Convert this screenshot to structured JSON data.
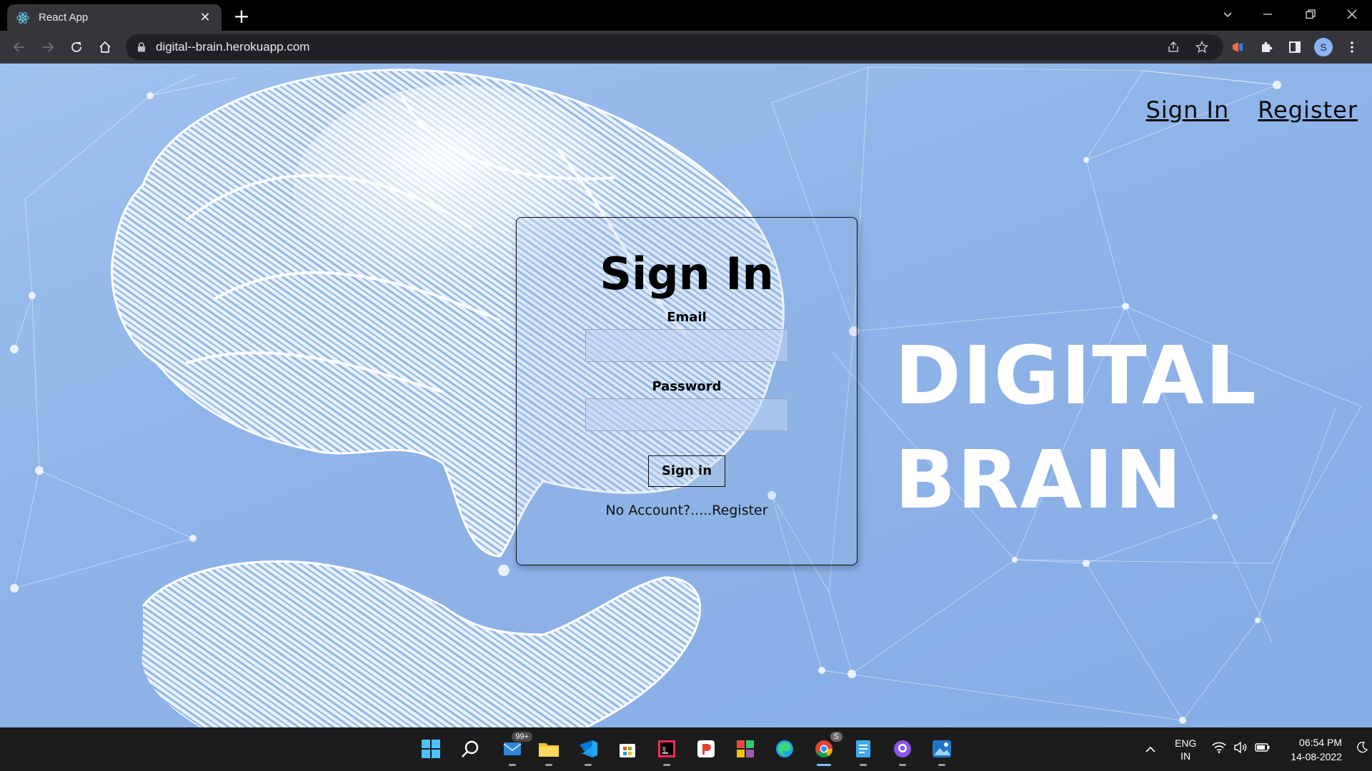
{
  "browser": {
    "tab_title": "React App",
    "url": "digital--brain.herokuapp.com",
    "profile_initial": "S"
  },
  "page": {
    "nav": {
      "signin": "Sign In",
      "register": "Register"
    },
    "hero": {
      "line1": "DIGITAL",
      "line2": "BRAIN"
    },
    "form": {
      "title": "Sign In",
      "email_label": "Email",
      "email_value": "",
      "password_label": "Password",
      "password_value": "",
      "button": "Sign in",
      "no_account": "No Account?.....Register"
    }
  },
  "taskbar": {
    "mail_badge": "99+",
    "chrome_badge": "S",
    "lang_line1": "ENG",
    "lang_line2": "IN",
    "time": "06:54 PM",
    "date": "14-08-2022"
  }
}
